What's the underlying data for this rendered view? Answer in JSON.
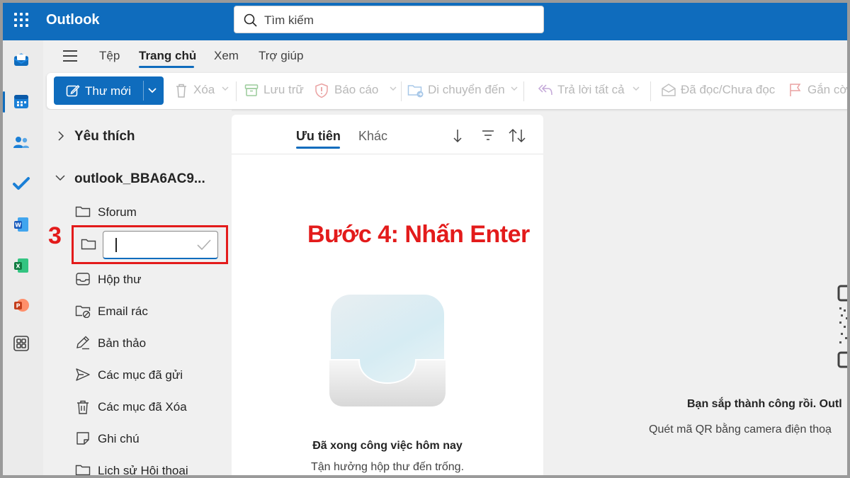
{
  "app": {
    "title": "Outlook"
  },
  "search": {
    "placeholder": "Tìm kiếm"
  },
  "ribbon": {
    "tabs": [
      "Tệp",
      "Trang chủ",
      "Xem",
      "Trợ giúp"
    ],
    "active_tab": "Trang chủ"
  },
  "toolbar": {
    "new_mail": "Thư mới",
    "delete": "Xóa",
    "archive": "Lưu trữ",
    "report": "Báo cáo",
    "move_to": "Di chuyển đến",
    "reply_all": "Trả lời tất cả",
    "read_unread": "Đã đọc/Chưa đọc",
    "flag": "Gắn cờ"
  },
  "folders": {
    "favorites": "Yêu thích",
    "account": "outlook_BBA6AC9...",
    "items": [
      {
        "label": "Sforum",
        "icon": "folder-icon"
      },
      {
        "label": "Hộp thư",
        "icon": "inbox-icon"
      },
      {
        "label": "Email rác",
        "icon": "junk-icon"
      },
      {
        "label": "Bản thảo",
        "icon": "draft-icon"
      },
      {
        "label": "Các mục đã gửi",
        "icon": "sent-icon"
      },
      {
        "label": "Các mục đã Xóa",
        "icon": "trash-icon"
      },
      {
        "label": "Ghi chú",
        "icon": "note-icon"
      },
      {
        "label": "Lịch sử Hội thoại",
        "icon": "folder-icon"
      }
    ],
    "new_folder_value": ""
  },
  "message_list": {
    "tabs": [
      "Ưu tiên",
      "Khác"
    ],
    "empty_title": "Đã xong công việc hôm nay",
    "empty_subtitle": "Tận hưởng hộp thư đến trống."
  },
  "reading_pane": {
    "qr_title": "Bạn sắp thành công rồi. Outl",
    "qr_subtitle": "Quét mã QR bằng camera điện thoạ"
  },
  "annotation": {
    "step_number": "3",
    "step_text": "Bước 4: Nhấn Enter",
    "color": "#e31b1b"
  },
  "colors": {
    "brand": "#0f6cbd",
    "annotation": "#e31b1b"
  }
}
